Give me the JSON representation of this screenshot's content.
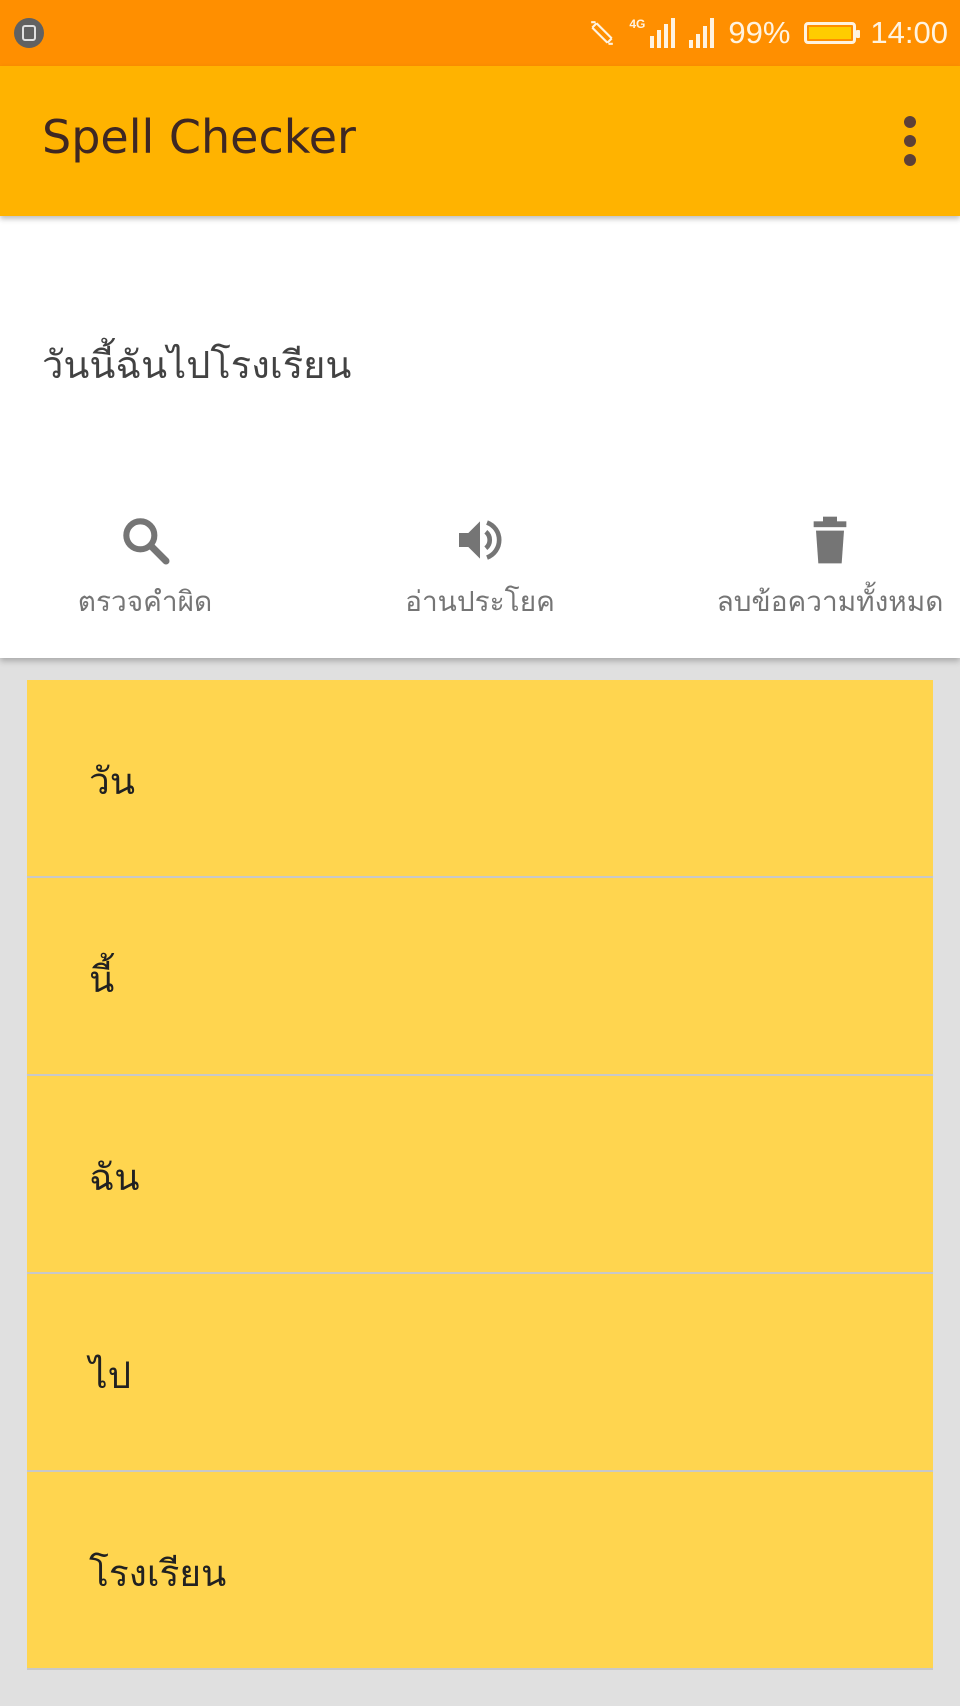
{
  "status_bar": {
    "battery": "99%",
    "time": "14:00",
    "network": "4G"
  },
  "app_bar": {
    "title": "Spell Checker"
  },
  "input": {
    "text": "วันนี้ฉันไปโรงเรียน"
  },
  "actions": [
    {
      "label": "ตรวจคำผิด",
      "icon": "search-icon"
    },
    {
      "label": "อ่านประโยค",
      "icon": "volume-icon"
    },
    {
      "label": "ลบข้อความทั้งหมด",
      "icon": "delete-icon"
    }
  ],
  "words": [
    "วัน",
    "นี้",
    "ฉัน",
    "ไป",
    "โรงเรียน"
  ],
  "colors": {
    "status_bar": "#ff8f00",
    "app_bar": "#ffb300",
    "word_card": "#ffd54f",
    "background": "#e0e0e0"
  }
}
